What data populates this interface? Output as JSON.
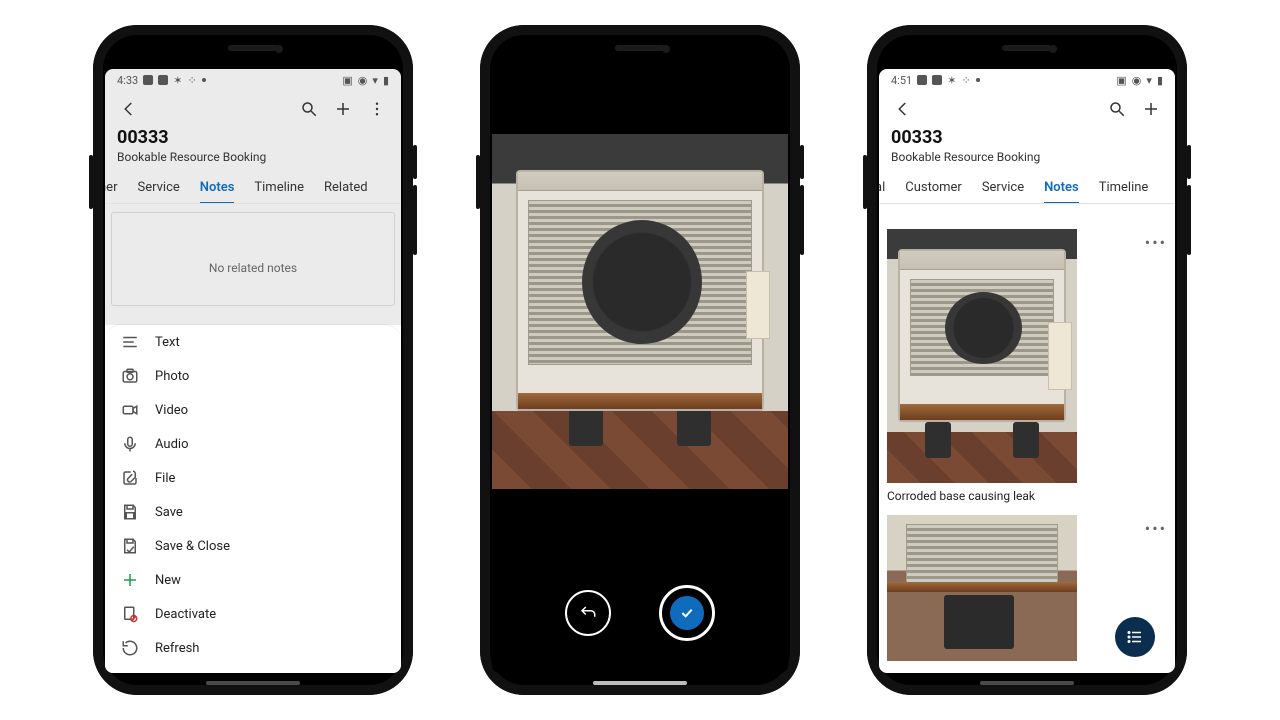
{
  "phone1": {
    "status_time": "4:33",
    "record_id": "00333",
    "record_sub": "Bookable Resource Booking",
    "tabs": [
      "ner",
      "Service",
      "Notes",
      "Timeline",
      "Related"
    ],
    "tabs_active_index": 2,
    "empty_msg": "No related notes",
    "sheet": [
      {
        "icon": "text-icon",
        "label": "Text"
      },
      {
        "icon": "photo-icon",
        "label": "Photo"
      },
      {
        "icon": "video-icon",
        "label": "Video"
      },
      {
        "icon": "audio-icon",
        "label": "Audio"
      },
      {
        "icon": "file-icon",
        "label": "File"
      },
      {
        "icon": "save-icon",
        "label": "Save"
      },
      {
        "icon": "save-close-icon",
        "label": "Save & Close"
      },
      {
        "icon": "new-icon",
        "label": "New"
      },
      {
        "icon": "deactivate-icon",
        "label": "Deactivate"
      },
      {
        "icon": "refresh-icon",
        "label": "Refresh"
      }
    ]
  },
  "phone2": {
    "back_label": "Retake",
    "confirm_label": "Use Photo"
  },
  "phone3": {
    "status_time": "4:51",
    "record_id": "00333",
    "record_sub": "Bookable Resource Booking",
    "tabs": [
      "al",
      "Customer",
      "Service",
      "Notes",
      "Timeline"
    ],
    "tabs_active_index": 3,
    "notes": [
      {
        "caption": "Corroded base causing leak"
      },
      {
        "caption": ""
      }
    ]
  }
}
